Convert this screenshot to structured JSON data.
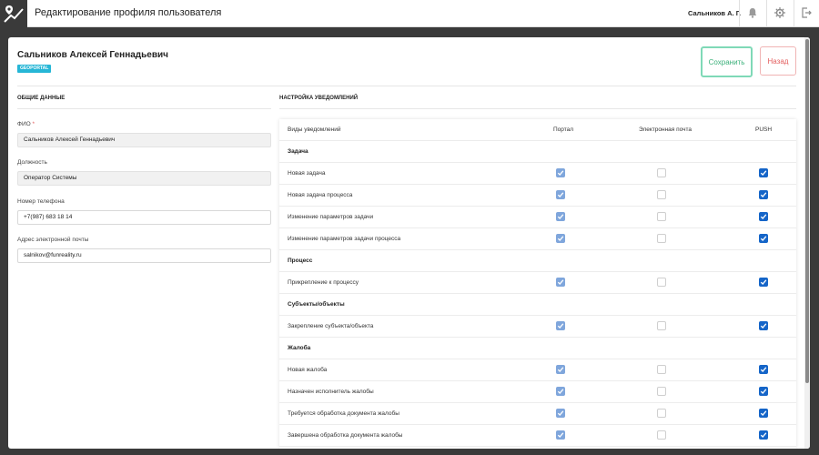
{
  "header": {
    "title": "Редактирование профиля пользователя",
    "user": "Сальников А. Г."
  },
  "profile": {
    "full_name": "Сальников Алексей Геннадьевич",
    "badge": "GEOPORTAL"
  },
  "actions": {
    "save": "Сохранить",
    "back": "Назад"
  },
  "general": {
    "title": "ОБЩИЕ ДАННЫЕ",
    "fio_label": "ФИО",
    "fio_required": "*",
    "fio_value": "Сальников Алексей Геннадьевич",
    "position_label": "Должность",
    "position_value": "Оператор Системы",
    "phone_label": "Номер телефона",
    "phone_value": "+7(987) 683 18 14",
    "email_label": "Адрес электронной почты",
    "email_value": "salnikov@funreality.ru"
  },
  "notifications": {
    "title": "НАСТРОЙКА УВЕДОМЛЕНИЙ",
    "columns": [
      "Виды уведомлений",
      "Портал",
      "Электронная почта",
      "PUSH"
    ],
    "rows": [
      {
        "type": "group",
        "label": "Задача"
      },
      {
        "type": "item",
        "label": "Новая задача",
        "portal": "disabled",
        "email": "off",
        "push": "on"
      },
      {
        "type": "item",
        "label": "Новая задача процесса",
        "portal": "disabled",
        "email": "off",
        "push": "on"
      },
      {
        "type": "item",
        "label": "Изменение параметров задачи",
        "portal": "disabled",
        "email": "off",
        "push": "on"
      },
      {
        "type": "item",
        "label": "Изменение параметров задачи процесса",
        "portal": "disabled",
        "email": "off",
        "push": "on"
      },
      {
        "type": "group",
        "label": "Процесс"
      },
      {
        "type": "item",
        "label": "Прикрепление к процессу",
        "portal": "disabled",
        "email": "off",
        "push": "on"
      },
      {
        "type": "group",
        "label": "Субъекты/объекты"
      },
      {
        "type": "item",
        "label": "Закрепление субъекта/объекта",
        "portal": "disabled",
        "email": "off",
        "push": "on"
      },
      {
        "type": "group",
        "label": "Жалоба"
      },
      {
        "type": "item",
        "label": "Новая жалоба",
        "portal": "disabled",
        "email": "off",
        "push": "on"
      },
      {
        "type": "item",
        "label": "Назначен исполнитель жалобы",
        "portal": "disabled",
        "email": "off",
        "push": "on"
      },
      {
        "type": "item",
        "label": "Требуется обработка документа жалобы",
        "portal": "disabled",
        "email": "off",
        "push": "on"
      },
      {
        "type": "item",
        "label": "Завершена обработка документа жалобы",
        "portal": "disabled",
        "email": "off",
        "push": "on"
      }
    ]
  },
  "icons": {
    "logo": "map-pin-logo-icon",
    "notifications": "bell-icon",
    "settings": "gear-icon",
    "logout": "logout-icon"
  },
  "colors": {
    "accent_cyan": "#26b6d6",
    "save_green": "#3bb07a",
    "back_red": "#e35d5d",
    "checkbox_on": "#1565c8",
    "checkbox_disabled": "#7fa6dc"
  }
}
